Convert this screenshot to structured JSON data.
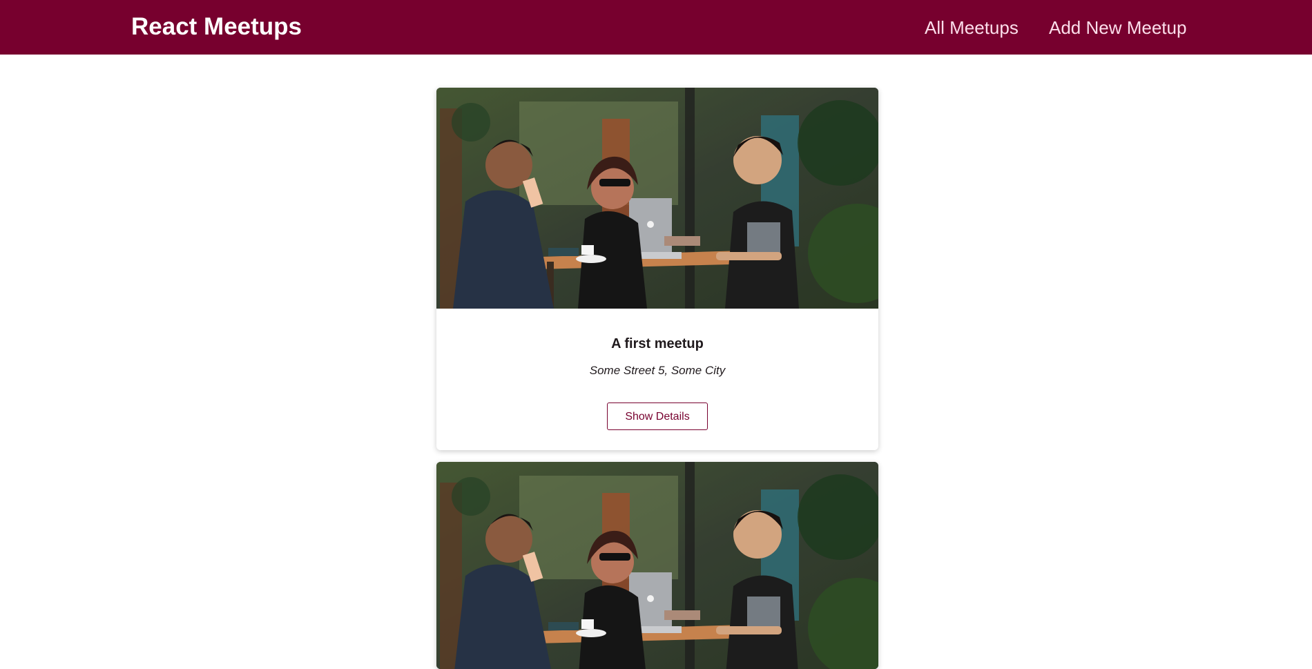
{
  "header": {
    "logo": "React Meetups",
    "nav": [
      {
        "label": "All Meetups"
      },
      {
        "label": "Add New Meetup"
      }
    ]
  },
  "meetups": [
    {
      "title": "A first meetup",
      "address": "Some Street 5, Some City",
      "action_label": "Show Details",
      "image_alt": "three people at a cafe table with a laptop"
    },
    {
      "title": "",
      "address": "",
      "action_label": "",
      "image_alt": "three people at a cafe table with a laptop"
    }
  ],
  "colors": {
    "header_bg": "#77002e",
    "nav_text": "#fcdeeb",
    "accent": "#77002e"
  }
}
